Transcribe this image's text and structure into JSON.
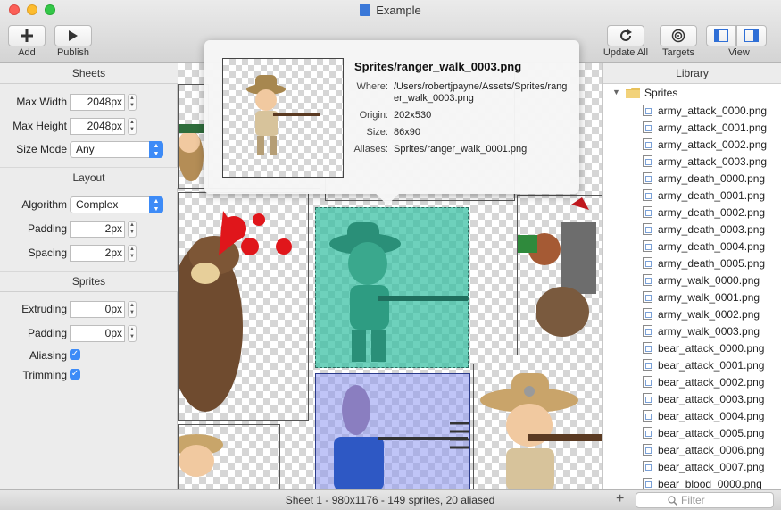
{
  "window": {
    "title": "Example"
  },
  "toolbar": {
    "add_label": "Add",
    "publish_label": "Publish",
    "update_all_label": "Update All",
    "targets_label": "Targets",
    "view_label": "View"
  },
  "sheets": {
    "heading": "Sheets",
    "max_width_label": "Max Width",
    "max_width_value": "2048px",
    "max_height_label": "Max Height",
    "max_height_value": "2048px",
    "size_mode_label": "Size Mode",
    "size_mode_value": "Any"
  },
  "layout": {
    "heading": "Layout",
    "algorithm_label": "Algorithm",
    "algorithm_value": "Complex",
    "padding_label": "Padding",
    "padding_value": "2px",
    "spacing_label": "Spacing",
    "spacing_value": "2px"
  },
  "sprites": {
    "heading": "Sprites",
    "extruding_label": "Extruding",
    "extruding_value": "0px",
    "padding_label": "Padding",
    "padding_value": "0px",
    "aliasing_label": "Aliasing",
    "aliasing_checked": true,
    "trimming_label": "Trimming",
    "trimming_checked": true
  },
  "popover": {
    "title": "Sprites/ranger_walk_0003.png",
    "where_label": "Where:",
    "where_value": "/Users/robertjpayne/Assets/Sprites/ranger_walk_0003.png",
    "origin_label": "Origin:",
    "origin_value": "202x530",
    "size_label": "Size:",
    "size_value": "86x90",
    "aliases_label": "Aliases:",
    "aliases_value": "Sprites/ranger_walk_0001.png"
  },
  "library": {
    "heading": "Library",
    "folder": "Sprites",
    "files": [
      "army_attack_0000.png",
      "army_attack_0001.png",
      "army_attack_0002.png",
      "army_attack_0003.png",
      "army_death_0000.png",
      "army_death_0001.png",
      "army_death_0002.png",
      "army_death_0003.png",
      "army_death_0004.png",
      "army_death_0005.png",
      "army_walk_0000.png",
      "army_walk_0001.png",
      "army_walk_0002.png",
      "army_walk_0003.png",
      "bear_attack_0000.png",
      "bear_attack_0001.png",
      "bear_attack_0002.png",
      "bear_attack_0003.png",
      "bear_attack_0004.png",
      "bear_attack_0005.png",
      "bear_attack_0006.png",
      "bear_attack_0007.png",
      "bear_blood_0000.png"
    ],
    "filter_placeholder": "Filter"
  },
  "status": {
    "text": "Sheet 1 - 980x1176 - 149 sprites, 20 aliased"
  },
  "colors": {
    "accent": "#3d8bf7",
    "selection_green": "#30bea0",
    "selection_blue": "#8c96f0"
  }
}
